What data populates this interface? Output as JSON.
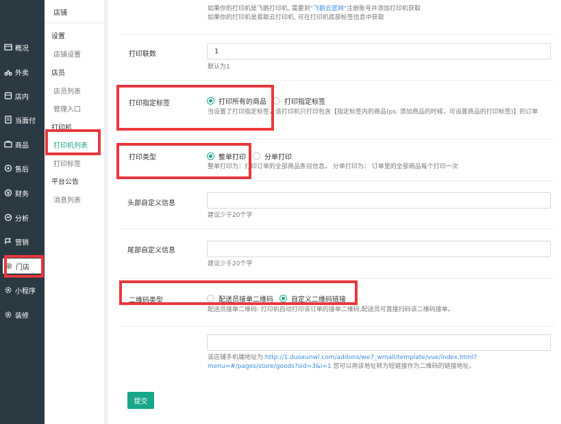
{
  "nav": {
    "items": [
      {
        "label": "概况",
        "icon": "dashboard-icon"
      },
      {
        "label": "外卖",
        "icon": "delivery-icon"
      },
      {
        "label": "店内",
        "icon": "store-icon"
      },
      {
        "label": "当面付",
        "icon": "receipt-icon"
      },
      {
        "label": "商品",
        "icon": "goods-icon"
      },
      {
        "label": "售后",
        "icon": "aftersale-icon"
      },
      {
        "label": "财务",
        "icon": "finance-icon"
      },
      {
        "label": "分析",
        "icon": "analysis-icon"
      },
      {
        "label": "营销",
        "icon": "marketing-icon"
      },
      {
        "label": "门店",
        "icon": "gear-icon"
      },
      {
        "label": "小程序",
        "icon": "miniapp-icon"
      },
      {
        "label": "装修",
        "icon": "decorate-icon"
      }
    ]
  },
  "submenu": {
    "title": "店铺",
    "groups": {
      "settings": "设置",
      "staff": "店员",
      "printer": "打印机",
      "notice": "平台公告"
    },
    "links": {
      "store_settings": "店铺设置",
      "staff_list": "店员列表",
      "admin_entry": "管理入口",
      "printer_list": "打印机列表",
      "print_tags": "打印标签",
      "message_list": "消息列表"
    }
  },
  "form": {
    "top_help_1_prefix": "如果你的打印机是飞鹅打印机, 需要到\"",
    "top_help_1_link": "飞鹅云官网",
    "top_help_1_suffix": "\"注册账号并添加打印机获取",
    "top_help_2": "如果你的打印机是易联云打印机, 可在打印机底部标签信息中获取",
    "copies": {
      "label": "打印联数",
      "value": "1",
      "help": "默认为1"
    },
    "tag": {
      "label": "打印指定标签",
      "option_all": "打印所有的商品",
      "option_tag": "打印指定标签",
      "help": "当设置了打印指定标签，该打印机只打印包含【指定标签内的商品(ps: 添加商品的时候，可设置商品的打印标签)】的订单"
    },
    "type": {
      "label": "打印类型",
      "option_whole": "整单打印",
      "option_split": "分单打印",
      "help": "整单打印为：打印订单的全部商品条目信息。 分单打印为： 订单里的全部商品每个打印一次"
    },
    "header": {
      "label": "头部自定义信息",
      "help": "建议少于20个字"
    },
    "footer": {
      "label": "尾部自定义信息",
      "help": "建议少于20个字"
    },
    "qrcode": {
      "label": "二维码类型",
      "option_rider": "配送员接单二维码",
      "option_custom": "自定义二维码链接",
      "help": "配送员接单二维码: 打印机自动打印该订单的接单二维码,配送员可直接扫码该二维码接单。"
    },
    "link": {
      "help_prefix": "该店铺手机端地址为:",
      "help_url_1": "http://1.duoxunwl.com/addons/we7_wmall/template/vue/index.html?",
      "help_url_2": "menu=#/pages/store/goods?sid=3&i=1",
      "help_suffix": " 您可以用该地址转为短链接作为二维码的链接地址。"
    },
    "submit": "提交"
  },
  "highlight_color": "#e8373c",
  "accent_color": "#18a689"
}
